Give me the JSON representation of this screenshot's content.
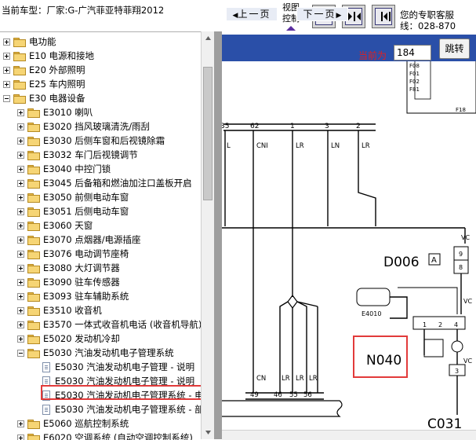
{
  "header": {
    "car_model": "当前车型：厂家:G-广汽菲亚特菲翔2012",
    "view_control": [
      "视图",
      "控制"
    ],
    "contact_line1": "您的专职客服",
    "contact_line2": "线：028-870"
  },
  "tree": {
    "items": [
      {
        "label": "电功能",
        "level": 0,
        "exp": "plus"
      },
      {
        "label": "E10 电源和接地",
        "level": 0,
        "exp": "plus"
      },
      {
        "label": "E20 外部照明",
        "level": 0,
        "exp": "plus"
      },
      {
        "label": "E25 车内照明",
        "level": 0,
        "exp": "plus"
      },
      {
        "label": "E30 电器设备",
        "level": 0,
        "exp": "minus"
      },
      {
        "label": "E3010 喇叭",
        "level": 1,
        "exp": "plus"
      },
      {
        "label": "E3020 挡风玻璃清洗/雨刮",
        "level": 1,
        "exp": "plus"
      },
      {
        "label": "E3030 后侧车窗和后视镜除霜",
        "level": 1,
        "exp": "plus"
      },
      {
        "label": "E3032 车门后视镜调节",
        "level": 1,
        "exp": "plus"
      },
      {
        "label": "E3040 中控门锁",
        "level": 1,
        "exp": "plus"
      },
      {
        "label": "E3045 后备箱和燃油加注口盖板开启",
        "level": 1,
        "exp": "plus"
      },
      {
        "label": "E3050 前侧电动车窗",
        "level": 1,
        "exp": "plus"
      },
      {
        "label": "E3051 后侧电动车窗",
        "level": 1,
        "exp": "plus"
      },
      {
        "label": "E3060 天窗",
        "level": 1,
        "exp": "plus"
      },
      {
        "label": "E3070 点烟器/电源插座",
        "level": 1,
        "exp": "plus"
      },
      {
        "label": "E3076 电动调节座椅",
        "level": 1,
        "exp": "plus"
      },
      {
        "label": "E3080 大灯调节器",
        "level": 1,
        "exp": "plus"
      },
      {
        "label": "E3090 驻车传感器",
        "level": 1,
        "exp": "plus"
      },
      {
        "label": "E3093 驻车辅助系统",
        "level": 1,
        "exp": "plus"
      },
      {
        "label": "E3510 收音机",
        "level": 1,
        "exp": "plus"
      },
      {
        "label": "E3570 一体式收音机电话 (收音机导航)",
        "level": 1,
        "exp": "plus"
      },
      {
        "label": "E5020 发动机冷却",
        "level": 1,
        "exp": "plus"
      },
      {
        "label": "E5030 汽油发动机电子管理系统",
        "level": 1,
        "exp": "minus"
      },
      {
        "label": "E5030 汽油发动机电子管理 - 说明",
        "level": 2,
        "doc": true
      },
      {
        "label": "E5030 汽油发动机电子管理 - 说明",
        "level": 2,
        "doc": true
      },
      {
        "label": "E5030 汽油发动机电子管理系统 - 电",
        "level": 2,
        "doc": true,
        "selected": true
      },
      {
        "label": "E5030 汽油发动机电子管理系统 - 部",
        "level": 2,
        "doc": true
      },
      {
        "label": "E5060 巡航控制系统",
        "level": 1,
        "exp": "plus"
      },
      {
        "label": "E6020 空调系统 (自动空调控制系统)",
        "level": 1,
        "exp": "plus"
      }
    ]
  },
  "nav": {
    "prev_label": "上一页",
    "next_label": "下一页",
    "current_label": "当前为",
    "current_page": "184",
    "jump_label": "跳转"
  },
  "diagram": {
    "fuse_labels": [
      "F08",
      "F01",
      "F02",
      "F81",
      "F18"
    ],
    "pin_numbers": [
      "35",
      "62",
      "1",
      "3",
      "2"
    ],
    "wire_labels": [
      "L",
      "CNI",
      "LR",
      "LN",
      "LR"
    ],
    "connector_d006": "D006",
    "connector_a": "A",
    "pin_9": "9",
    "pin_8": "8",
    "pin_4": "4",
    "pin_3": "3",
    "pin_1": "1",
    "pin_2": "2",
    "vc_labels": [
      "VC",
      "VC",
      "VC"
    ],
    "e4010": "E4010",
    "n040": "N040",
    "bottom_wire_labels": [
      "CN",
      "LR",
      "LR",
      "LR"
    ],
    "bottom_pins": [
      "49",
      "46",
      "55",
      "56"
    ],
    "c031": "C031"
  },
  "colors": {
    "nav_bg": "#2a4fa8",
    "highlight_red": "#e23b3b",
    "current_label": "#e02020"
  }
}
